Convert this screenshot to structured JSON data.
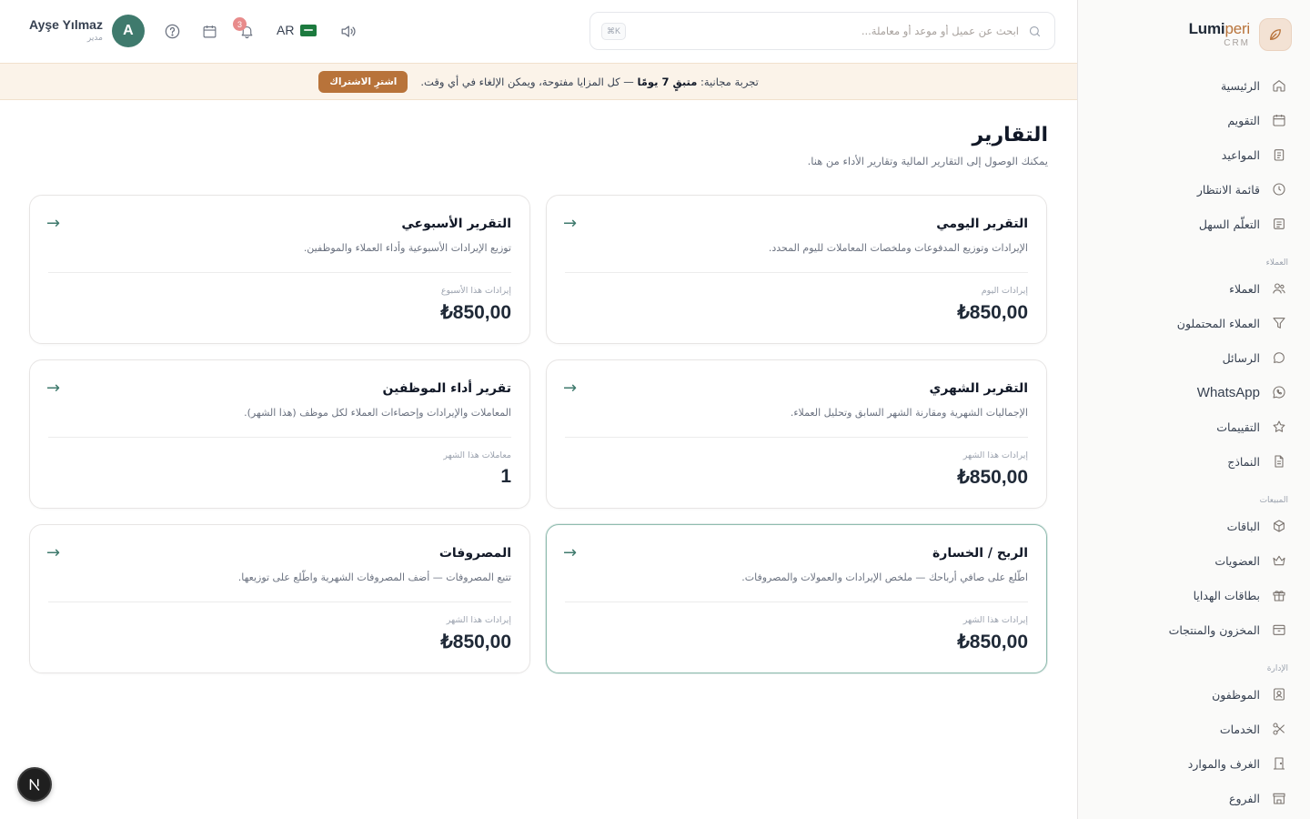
{
  "brand": {
    "name_part1": "Lumi",
    "name_part2": "peri",
    "subtitle": "CRM"
  },
  "sidebar": {
    "items": [
      {
        "label": "الرئيسية",
        "icon": "home-icon"
      },
      {
        "label": "التقويم",
        "icon": "calendar-icon"
      },
      {
        "label": "المواعيد",
        "icon": "clipboard-icon"
      },
      {
        "label": "قائمة الانتظار",
        "icon": "clock-icon"
      },
      {
        "label": "التعلّم السهل",
        "icon": "book-icon"
      }
    ],
    "section_customers": "العملاء",
    "customer_items": [
      {
        "label": "العملاء",
        "icon": "users-icon"
      },
      {
        "label": "العملاء المحتملون",
        "icon": "filter-icon"
      },
      {
        "label": "الرسائل",
        "icon": "chat-icon"
      },
      {
        "label": "WhatsApp",
        "icon": "whatsapp-icon"
      },
      {
        "label": "التقييمات",
        "icon": "star-icon"
      },
      {
        "label": "النماذج",
        "icon": "document-icon"
      }
    ],
    "section_sales": "المبيعات",
    "sales_items": [
      {
        "label": "الباقات",
        "icon": "box-icon"
      },
      {
        "label": "العضويات",
        "icon": "crown-icon"
      },
      {
        "label": "بطاقات الهدايا",
        "icon": "gift-icon"
      },
      {
        "label": "المخزون والمنتجات",
        "icon": "inventory-icon"
      }
    ],
    "section_admin": "الإدارة",
    "admin_items": [
      {
        "label": "الموظفون",
        "icon": "staff-icon"
      },
      {
        "label": "الخدمات",
        "icon": "scissors-icon"
      },
      {
        "label": "الغرف والموارد",
        "icon": "door-icon"
      },
      {
        "label": "الفروع",
        "icon": "store-icon"
      }
    ]
  },
  "header": {
    "user_name": "Ayşe Yılmaz",
    "user_role": "مدير",
    "avatar_initial": "A",
    "notification_count": "3",
    "language_code": "AR",
    "search_placeholder": "ابحث عن عميل أو موعد أو معاملة...",
    "search_shortcut": "K⌘"
  },
  "banner": {
    "text_prefix": "تجربة مجانية: ",
    "text_bold": "متبقٍ 7 يومًا",
    "text_suffix": " — كل المزايا مفتوحة، ويمكن الإلغاء في أي وقت.",
    "button_label": "اشترِ الاشتراك"
  },
  "page": {
    "title": "التقارير",
    "subtitle": "يمكنك الوصول إلى التقارير المالية وتقارير الأداء من هنا."
  },
  "reports": [
    {
      "title": "التقرير اليومي",
      "description": "الإيرادات وتوزيع المدفوعات وملخصات المعاملات لليوم المحدد.",
      "metric_label": "إيرادات اليوم",
      "metric_value": "₺850,00",
      "arrow": "→"
    },
    {
      "title": "التقرير الأسبوعي",
      "description": "توزيع الإيرادات الأسبوعية وأداء العملاء والموظفين.",
      "metric_label": "إيرادات هذا الأسبوع",
      "metric_value": "₺850,00",
      "arrow": "→"
    },
    {
      "title": "التقرير الشهري",
      "description": "الإجماليات الشهرية ومقارنة الشهر السابق وتحليل العملاء.",
      "metric_label": "إيرادات هذا الشهر",
      "metric_value": "₺850,00",
      "arrow": "→"
    },
    {
      "title": "تقرير أداء الموظفين",
      "description": "المعاملات والإيرادات وإحصاءات العملاء لكل موظف (هذا الشهر).",
      "metric_label": "معاملات هذا الشهر",
      "metric_value": "1",
      "arrow": "→"
    },
    {
      "title": "الربح / الخسارة",
      "description": "اطّلع على صافي أرباحك — ملخص الإيرادات والعمولات والمصروفات.",
      "metric_label": "إيرادات هذا الشهر",
      "metric_value": "₺850,00",
      "arrow": "→"
    },
    {
      "title": "المصروفات",
      "description": "تتبع المصروفات — أضف المصروفات الشهرية واطّلع على توزيعها.",
      "metric_label": "إيرادات هذا الشهر",
      "metric_value": "₺850,00",
      "arrow": "→"
    }
  ],
  "colors": {
    "brand_accent": "#b8733a",
    "primary": "#3f7a6d",
    "banner_bg": "#fbf3e9",
    "badge": "#e88b8b"
  },
  "fab": {
    "label": "N"
  }
}
